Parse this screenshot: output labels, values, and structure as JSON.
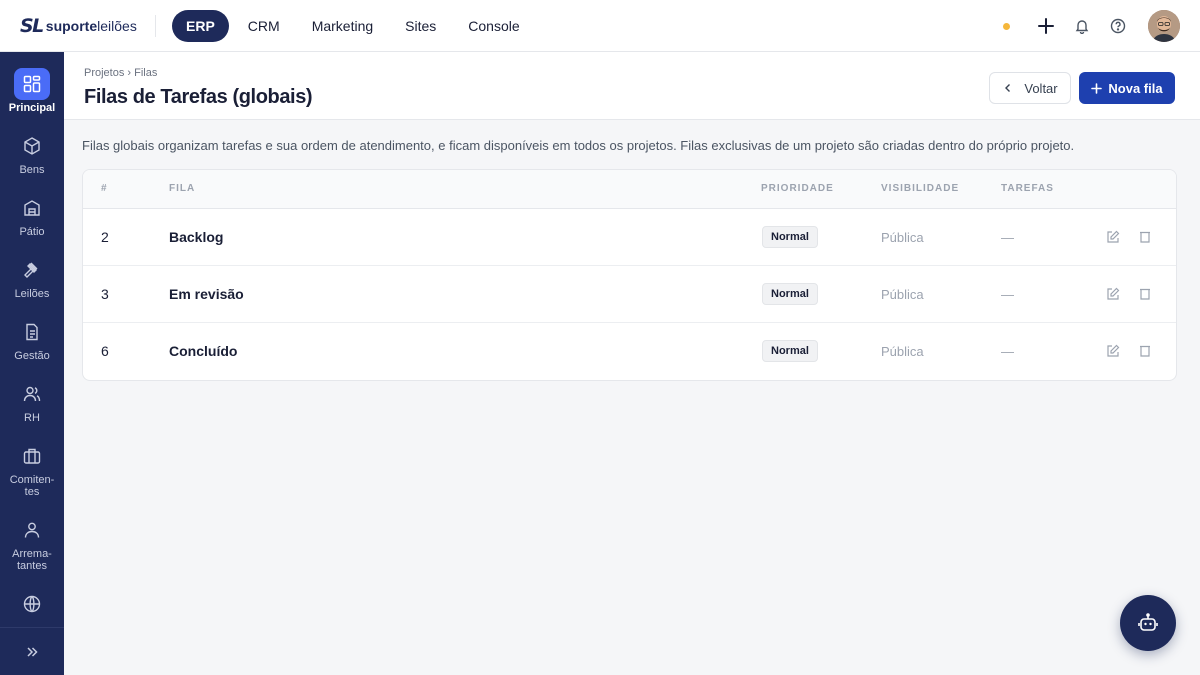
{
  "brand": {
    "mark": "SL",
    "bold": "suporte",
    "light": "leilões"
  },
  "nav": {
    "items": [
      "ERP",
      "CRM",
      "Marketing",
      "Sites",
      "Console"
    ],
    "active": "ERP"
  },
  "topbar_icons": [
    "status-dot",
    "plus-icon",
    "bell-icon",
    "help-icon",
    "avatar"
  ],
  "sidebar": {
    "items": [
      {
        "label": "Principal",
        "icon": "grid-icon",
        "active": true
      },
      {
        "label": "Bens",
        "icon": "box-icon"
      },
      {
        "label": "Pátio",
        "icon": "warehouse-icon"
      },
      {
        "label": "Leilões",
        "icon": "gavel-icon"
      },
      {
        "label": "Gestão",
        "icon": "document-icon"
      },
      {
        "label": "RH",
        "icon": "users-icon"
      },
      {
        "label": "Comiten-tes",
        "icon": "briefcase-icon"
      },
      {
        "label": "Arrema-tantes",
        "icon": "user-icon"
      },
      {
        "label": "",
        "icon": "globe-icon"
      }
    ],
    "expand_icon": "chevrons-right-icon"
  },
  "header": {
    "breadcrumb": "Projetos › Filas",
    "title": "Filas de Tarefas (globais)",
    "back_label": "Voltar",
    "new_label": "Nova fila"
  },
  "description": "Filas globais organizam tarefas e sua ordem de atendimento, e ficam disponíveis em todos os projetos. Filas exclusivas de um projeto são criadas dentro do próprio projeto.",
  "table": {
    "columns": [
      "#",
      "Fila",
      "Prioridade",
      "Visibilidade",
      "Tarefas"
    ],
    "rows": [
      {
        "id": "2",
        "name": "Backlog",
        "priority": "Normal",
        "visibility": "Pública",
        "tasks": "—"
      },
      {
        "id": "3",
        "name": "Em revisão",
        "priority": "Normal",
        "visibility": "Pública",
        "tasks": "—"
      },
      {
        "id": "6",
        "name": "Concluído",
        "priority": "Normal",
        "visibility": "Pública",
        "tasks": "—"
      }
    ]
  },
  "colors": {
    "navy": "#1e2a5a",
    "primary": "#1e40af",
    "accent": "#4a6cf7",
    "status_dot": "#f5b73b"
  }
}
